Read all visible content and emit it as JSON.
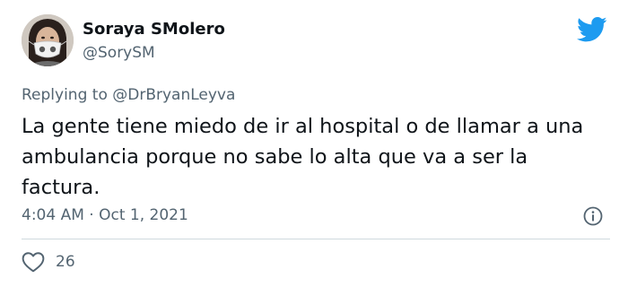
{
  "author": {
    "display_name": "Soraya SMolero",
    "handle": "@SorySM"
  },
  "reply": {
    "prefix": "Replying to ",
    "mention": "@DrBryanLeyva"
  },
  "tweet": {
    "text": "La gente tiene miedo de ir al hospital o de llamar a una\nambulancia porque no sabe lo alta que va a ser la\nfactura."
  },
  "meta": {
    "timestamp": "4:04 AM · Oct 1, 2021"
  },
  "engagement": {
    "likes": "26"
  },
  "icons": {
    "brand": "twitter-bird-icon",
    "info": "info-icon",
    "like": "heart-icon"
  },
  "colors": {
    "brand": "#1d9bf0",
    "text": "#0f1419",
    "muted": "#536471",
    "divider": "#cfd9de"
  }
}
